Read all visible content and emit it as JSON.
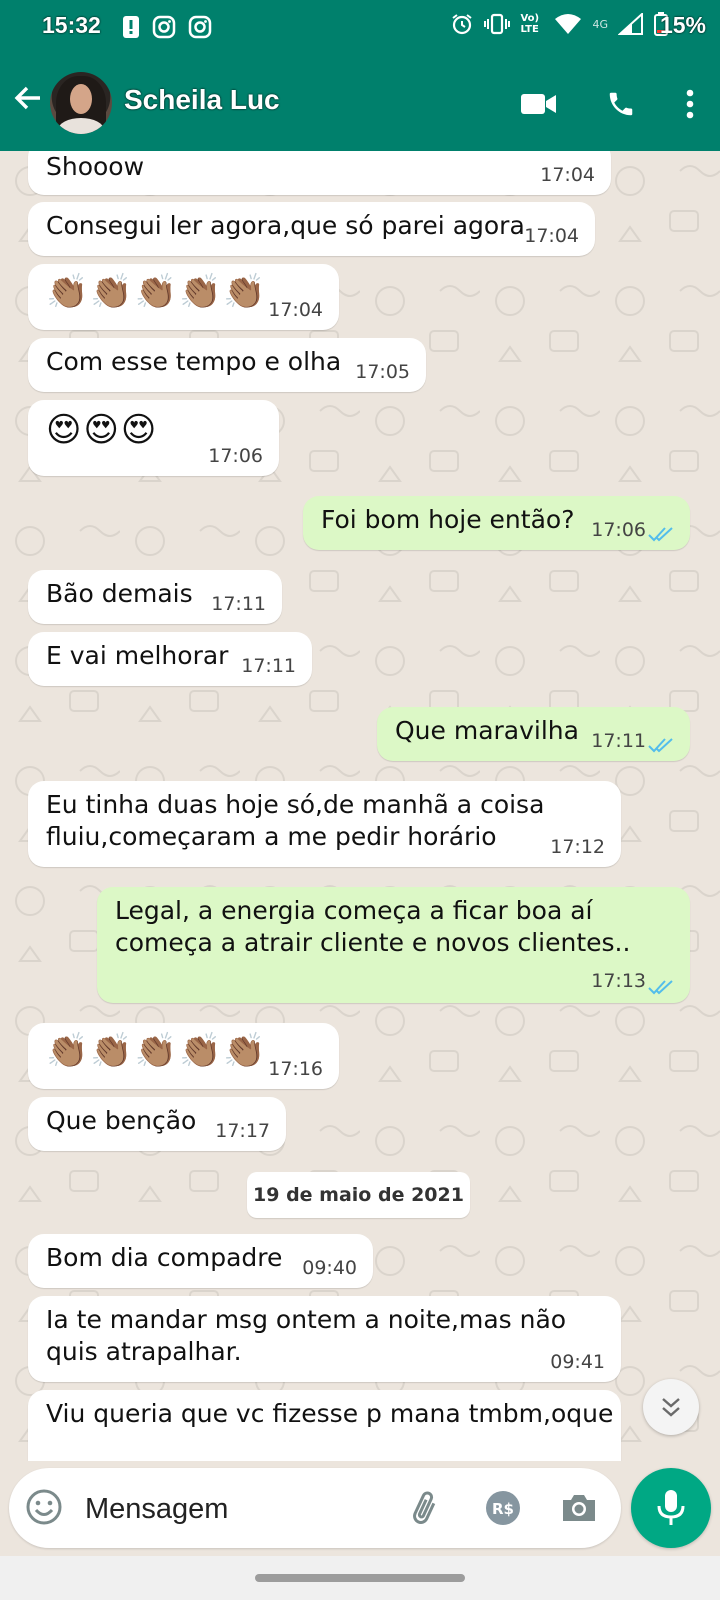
{
  "status_bar": {
    "time": "15:32",
    "battery": "15%",
    "network_label": "4G",
    "volte_label": "Vo) LTE"
  },
  "header": {
    "contact_name": "Scheila Luc"
  },
  "messages": [
    {
      "text": "Shooow",
      "time": "17:04",
      "dir": "in"
    },
    {
      "text": "Consegui ler agora,que só parei agora",
      "time": "17:04",
      "dir": "in"
    },
    {
      "text": "👏🏽👏🏽👏🏽👏🏽👏🏽",
      "time": "17:04",
      "dir": "in"
    },
    {
      "text": "Com esse tempo e olha",
      "time": "17:05",
      "dir": "in"
    },
    {
      "text": "😍😍😍",
      "time": "17:06",
      "dir": "in"
    },
    {
      "text": "Foi bom hoje então?",
      "time": "17:06",
      "dir": "out"
    },
    {
      "text": "Bão demais",
      "time": "17:11",
      "dir": "in"
    },
    {
      "text": "E vai melhorar",
      "time": "17:11",
      "dir": "in"
    },
    {
      "text": "Que maravilha",
      "time": "17:11",
      "dir": "out"
    },
    {
      "text": "Eu tinha duas hoje só,de manhã a coisa\nfluiu,começaram a me pedir horário",
      "time": "17:12",
      "dir": "in"
    },
    {
      "text": "Legal, a energia começa a ficar boa aí\ncomeça a atrair cliente e novos clientes..",
      "time": "17:13",
      "dir": "out"
    },
    {
      "text": "👏🏽👏🏽👏🏽👏🏽👏🏽",
      "time": "17:16",
      "dir": "in"
    },
    {
      "text": "Que benção",
      "time": "17:17",
      "dir": "in"
    },
    {
      "text": "Bom dia compadre",
      "time": "09:40",
      "dir": "in"
    },
    {
      "text": "Ia te mandar msg ontem a noite,mas não\nquis atrapalhar.",
      "time": "09:41",
      "dir": "in"
    },
    {
      "text": "Viu queria que vc fizesse p mana tmbm,oque",
      "time": "",
      "dir": "in"
    }
  ],
  "date_divider": "19 de maio de 2021",
  "composer": {
    "placeholder": "Mensagem"
  },
  "colors": {
    "header": "#00806c",
    "outgoing_bubble": "#dcf8c6",
    "incoming_bubble": "#ffffff",
    "read_ticks": "#53bdeb",
    "mic_button": "#00a884"
  },
  "icons": [
    "back-arrow-icon",
    "video-call-icon",
    "voice-call-icon",
    "more-options-icon",
    "emoji-icon",
    "attach-icon",
    "pix-icon",
    "camera-icon",
    "mic-icon",
    "chevron-down-icon"
  ]
}
